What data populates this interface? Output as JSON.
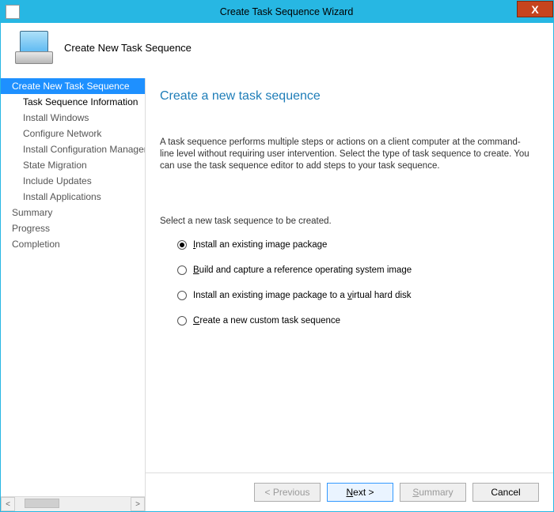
{
  "window": {
    "title": "Create Task Sequence Wizard",
    "close_label": "X"
  },
  "header": {
    "title": "Create New Task Sequence"
  },
  "sidebar": {
    "items": [
      {
        "label": "Create New Task Sequence",
        "level": "grp",
        "state": "active"
      },
      {
        "label": "Task Sequence Information",
        "level": "child",
        "state": "next"
      },
      {
        "label": "Install Windows",
        "level": "child",
        "state": ""
      },
      {
        "label": "Configure Network",
        "level": "child",
        "state": ""
      },
      {
        "label": "Install Configuration Manager",
        "level": "child",
        "state": ""
      },
      {
        "label": "State Migration",
        "level": "child",
        "state": ""
      },
      {
        "label": "Include Updates",
        "level": "child",
        "state": ""
      },
      {
        "label": "Install Applications",
        "level": "child",
        "state": ""
      },
      {
        "label": "Summary",
        "level": "grp",
        "state": ""
      },
      {
        "label": "Progress",
        "level": "grp",
        "state": ""
      },
      {
        "label": "Completion",
        "level": "grp",
        "state": ""
      }
    ],
    "scroll": {
      "left": "<",
      "right": ">"
    }
  },
  "content": {
    "heading": "Create a new task sequence",
    "description": "A task sequence performs multiple steps or actions on a client computer at the command-line level without requiring user intervention. Select the type of task sequence to create. You can use the task sequence editor to add steps to your task sequence.",
    "prompt": "Select a new task sequence to be created.",
    "options": [
      {
        "html": "<u>I</u>nstall an existing image package",
        "checked": true
      },
      {
        "html": "<u>B</u>uild and capture a reference operating system image",
        "checked": false
      },
      {
        "html": "Install an existing image package to a <u>v</u>irtual hard disk",
        "checked": false
      },
      {
        "html": "<u>C</u>reate a new custom task sequence",
        "checked": false
      }
    ]
  },
  "footer": {
    "previous": "< Previous",
    "next_html": "<u>N</u>ext >",
    "summary_html": "<u>S</u>ummary",
    "cancel": "Cancel"
  }
}
